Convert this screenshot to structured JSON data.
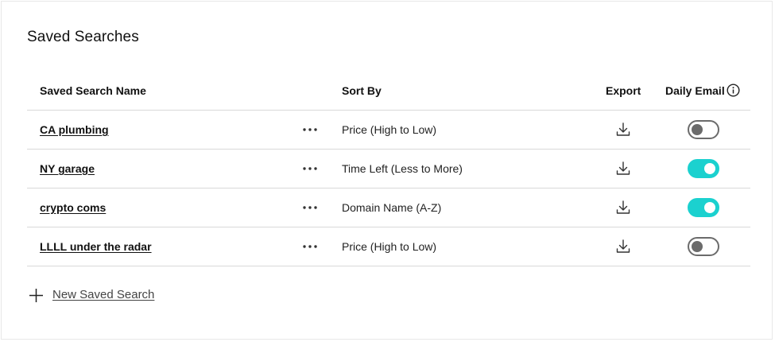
{
  "title": "Saved Searches",
  "table": {
    "headers": {
      "name": "Saved Search Name",
      "sort_by": "Sort By",
      "export": "Export",
      "daily_email": "Daily Email"
    },
    "rows": [
      {
        "name": "CA plumbing",
        "sort_by": "Price (High to Low)",
        "daily_email_enabled": false
      },
      {
        "name": "NY garage",
        "sort_by": "Time Left (Less to More)",
        "daily_email_enabled": true
      },
      {
        "name": "crypto coms",
        "sort_by": "Domain Name (A-Z)",
        "daily_email_enabled": true
      },
      {
        "name": "LLLL under the radar",
        "sort_by": "Price (High to Low)",
        "daily_email_enabled": false
      }
    ]
  },
  "actions": {
    "new_saved_search_label": "New Saved Search"
  },
  "icons": {
    "info": "info-icon",
    "more": "more-horizontal-icon",
    "export": "download-icon",
    "add": "plus-icon"
  },
  "colors": {
    "toggle_on": "#1bd1cf",
    "toggle_off": "#6b6b6b"
  }
}
